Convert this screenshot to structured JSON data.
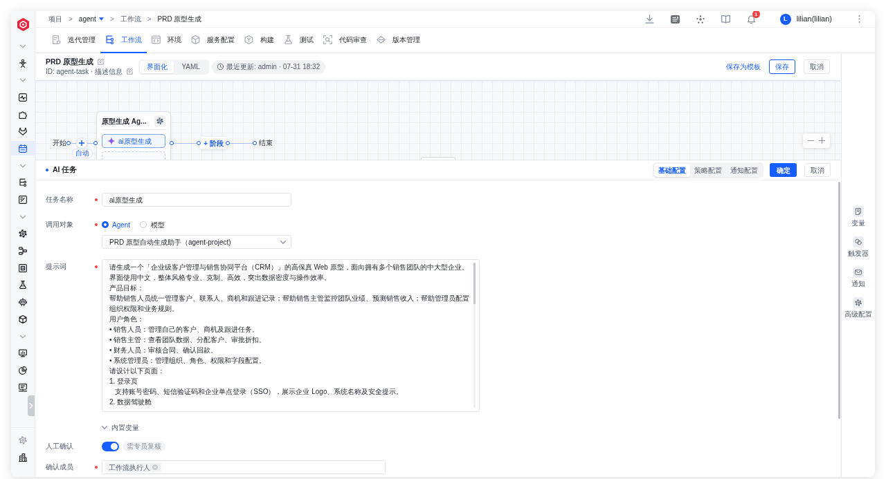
{
  "sidebar": {
    "groups": [
      {
        "expanded": true,
        "items": [
          {
            "selected": false
          }
        ]
      },
      {
        "expanded": true,
        "items": [
          {
            "selected": false
          },
          {
            "selected": false
          },
          {
            "selected": false
          },
          {
            "selected": true
          }
        ]
      },
      {
        "expanded": true,
        "items": [
          {
            "selected": false
          },
          {
            "selected": false
          }
        ]
      },
      {
        "expanded": true,
        "items": [
          {
            "selected": false
          },
          {
            "selected": false
          },
          {
            "selected": false
          },
          {
            "selected": false
          },
          {
            "selected": false
          },
          {
            "selected": false
          }
        ]
      },
      {
        "expanded": true,
        "items": [
          {
            "selected": false
          },
          {
            "selected": false
          },
          {
            "selected": false
          }
        ]
      }
    ]
  },
  "breadcrumb": {
    "items": [
      {
        "label": "项目",
        "dropdown": false
      },
      {
        "separator": ">",
        "label": "agent",
        "dropdown": true
      },
      {
        "separator": ">",
        "label": "工作流",
        "dropdown": false
      },
      {
        "separator": ">",
        "label": "PRD 原型生成",
        "dropdown": false
      }
    ]
  },
  "header": {
    "notification_count": "1",
    "user": {
      "initial": "L",
      "name": "lilian(lilian)"
    }
  },
  "tabs": [
    {
      "label": "迭代管理",
      "selected": false
    },
    {
      "label": "工作流",
      "selected": true
    },
    {
      "label": "环境",
      "selected": false
    },
    {
      "label": "服务配置",
      "selected": false
    },
    {
      "label": "构建",
      "selected": false
    },
    {
      "label": "测试",
      "selected": false
    },
    {
      "label": "代码审查",
      "selected": false
    },
    {
      "label": "版本管理",
      "selected": false
    }
  ],
  "workflow": {
    "title": "PRD 原型生成",
    "subtitle": "ID: agent-task · 描述信息",
    "views": [
      {
        "label": "界面化",
        "selected": true
      },
      {
        "label": "YAML",
        "selected": false
      }
    ],
    "last_updated": "最近更新: admin · 07-31 18:32",
    "save_template": "保存为模板",
    "save": "保存",
    "cancel": "取消"
  },
  "canvas": {
    "start": "开始",
    "trigger": "自动",
    "stage": {
      "title": "原型生成 Ag...",
      "tasks": [
        {
          "label": "ai原型生成",
          "selected": true
        }
      ]
    },
    "add_stage": "+ 阶段",
    "end": "结束"
  },
  "task_panel": {
    "title": "AI 任务",
    "tabs": [
      {
        "label": "基础配置",
        "selected": true
      },
      {
        "label": "策略配置",
        "selected": false
      },
      {
        "label": "通知配置",
        "selected": false
      }
    ],
    "confirm": "确定",
    "cancel": "取消"
  },
  "form": [
    {
      "kind": "text",
      "label": "任务名称",
      "required": true,
      "value": "ai原型生成"
    },
    {
      "kind": "radio",
      "label": "调用对象",
      "required": true,
      "options": [
        {
          "label": "Agent",
          "selected": true
        },
        {
          "label": "模型",
          "selected": false
        }
      ]
    },
    {
      "kind": "select",
      "value": "PRD 原型自动生成助手（agent-project)"
    },
    {
      "kind": "textarea",
      "label": "提示词",
      "required": true,
      "lines": [
        "请生成一个「企业级客户管理与销售协同平台（CRM）」的高保真 Web 原型，面向拥有多个销售团队的中大型企业。界面使用中文，整体风格专业、克制、高效，突出数据密度与操作效率。",
        "产品目标：",
        "帮助销售人员统一管理客户、联系人、商机和跟进记录；帮助销售主管监控团队业绩、预测销售收入；帮助管理员配置组织权限和业务规则。",
        "用户角色：",
        "• 销售人员：管理自己的客户、商机及跟进任务。",
        "• 销售主管：查看团队数据、分配客户、审批折扣。",
        "• 财务人员：审核合同、确认回款。",
        "• 系统管理员：管理组织、角色、权限和字段配置。",
        "请设计以下页面：",
        "1. 登录页",
        "   支持账号密码、短信验证码和企业单点登录（SSO），展示企业 Logo、系统名称及安全提示。",
        "2. 数据驾驶舱"
      ]
    },
    {
      "kind": "collapsible",
      "label": "内置变量",
      "expanded": false
    },
    {
      "kind": "toggle",
      "label": "人工确认",
      "required": false,
      "on": true,
      "tag": "需专员复核"
    },
    {
      "kind": "tags",
      "label": "确认成员",
      "required": true,
      "tags": [
        "工作流执行人"
      ]
    }
  ],
  "side_tools": [
    {
      "label": "变量"
    },
    {
      "label": "触发器"
    },
    {
      "label": "通知"
    },
    {
      "label": "高级配置"
    }
  ]
}
